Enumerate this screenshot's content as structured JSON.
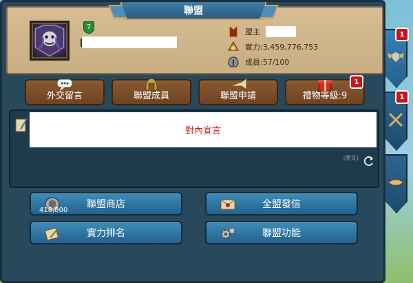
{
  "header": {
    "title": "聯盟"
  },
  "alliance": {
    "level": "7",
    "leader_label": "盟主",
    "power_label": "實力:3,459,776,753",
    "members_label": "成員:57/100"
  },
  "actions": [
    {
      "label": "外交留言",
      "icon": "chat-bubble-icon"
    },
    {
      "label": "聯盟成員",
      "icon": "helmet-icon"
    },
    {
      "label": "聯盟申請",
      "icon": "trumpet-icon"
    },
    {
      "label": "禮物等級:9",
      "icon": "gift-icon",
      "badge": "1"
    }
  ],
  "announcement": {
    "text": "對內宣言",
    "original_label": "(原文)"
  },
  "menu": {
    "shop_label": "聯盟商店",
    "shop_count": "418,800",
    "mail_label": "全盟發信",
    "ranking_label": "實力排名",
    "functions_label": "聯盟功能"
  },
  "side_tabs": [
    {
      "icon": "winged-shield-icon",
      "badge": "1"
    },
    {
      "icon": "crossed-swords-icon",
      "badge": "1"
    },
    {
      "icon": "handshake-icon",
      "badge": ""
    }
  ],
  "colors": {
    "announcement_text": "#d01a1a",
    "badge_red": "#c8161e",
    "level_green": "#2e8a3c"
  }
}
